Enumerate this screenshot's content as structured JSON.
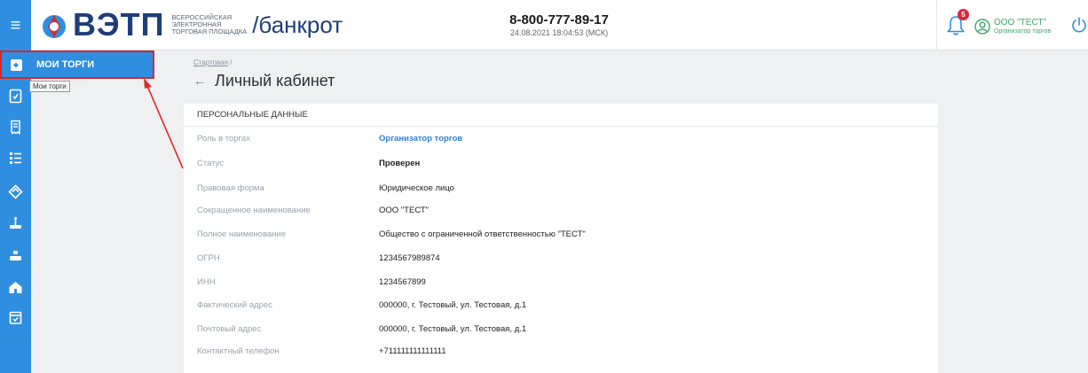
{
  "header": {
    "logo_text": "ВЭТП",
    "logo_sub": [
      "ВСЕРОССИЙСКАЯ",
      "ЭЛЕКТРОННАЯ",
      "ТОРГОВАЯ ПЛОЩАДКА"
    ],
    "section": "/банкрот",
    "phone": "8-800-777-89-17",
    "datetime": "24.08.2021 18:04:53 (МСК)",
    "notifications_count": "5",
    "user_name": "ООО \"ТЕСТ\"",
    "user_role": "Организатор торгов"
  },
  "sidebar": {
    "active_label": "МОИ ТОРГИ",
    "tooltip": "Мои торги",
    "icons": [
      "document-icon",
      "receipt-icon",
      "list-icon",
      "auction-icon",
      "scale-icon",
      "scale-alt-icon",
      "house-icon",
      "calendar-icon"
    ]
  },
  "main": {
    "breadcrumb": [
      "Стартовая",
      "/"
    ],
    "title": "Личный кабинет",
    "card_title": "ПЕРСОНАЛЬНЫЕ ДАННЫЕ",
    "rows": [
      {
        "label": "Роль в торгах",
        "value": "Организатор торгов"
      },
      {
        "label": "Статус",
        "value": "Проверен"
      },
      {
        "label": "Правовая форма",
        "value": "Юридическое лицо"
      },
      {
        "label": "Сокращенное наименование",
        "value": "ООО \"ТЕСТ\""
      },
      {
        "label": "Полное наименование",
        "value": "Общество с ограниченной ответственностью \"ТЕСТ\""
      },
      {
        "label": "ОГРН",
        "value": "1234567989874"
      },
      {
        "label": "ИНН",
        "value": "1234567899"
      },
      {
        "label": "Фактический адрес",
        "value": "000000, г. Тестовый, ул. Тестовая, д.1"
      },
      {
        "label": "Почтовый адрес",
        "value": "000000, г. Тестовый, ул. Тестовая, д.1"
      },
      {
        "label": "Контактный телефон",
        "value": "+711111111111111"
      }
    ]
  },
  "colors": {
    "accent": "#2f8ee0",
    "brand": "#1e3d7a",
    "highlight": "#d8262e",
    "user": "#3aa76d"
  }
}
